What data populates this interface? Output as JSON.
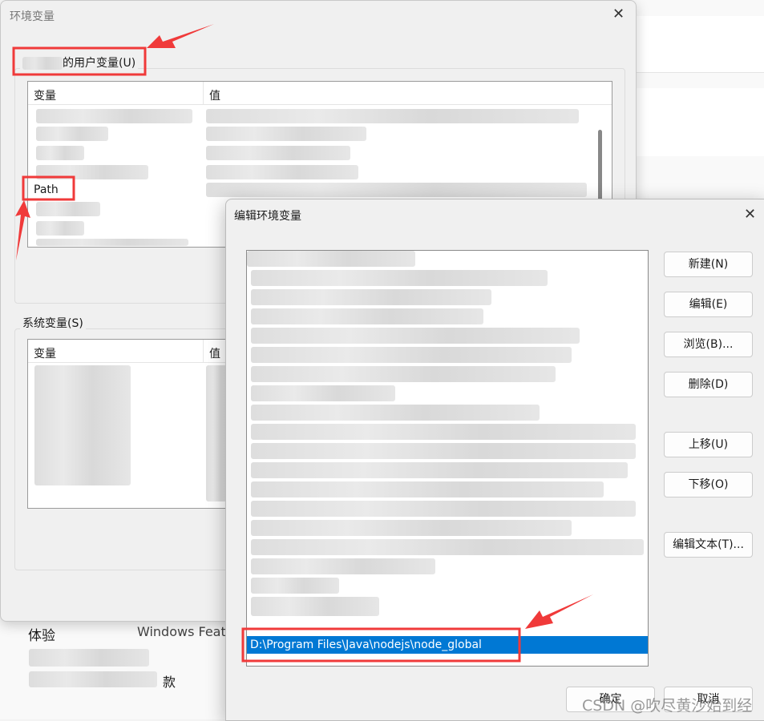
{
  "background_window": {
    "item_1": "体验",
    "item_2": "Windows Feat",
    "item_3": "款"
  },
  "env_dialog": {
    "title": "环境变量",
    "close_icon": "close-icon",
    "user_vars_label": "的用户变量(U)",
    "user_columns": [
      "变量",
      "值"
    ],
    "user_rows": [
      {
        "name": "Path",
        "value": ""
      }
    ],
    "system_vars_label": "系统变量(S)",
    "system_columns": [
      "变量",
      "值"
    ]
  },
  "edit_dialog": {
    "title": "编辑环境变量",
    "close_icon": "close-icon",
    "selected_entry": "D:\\Program Files\\Java\\nodejs\\node_global",
    "buttons": {
      "new": "新建(N)",
      "edit": "编辑(E)",
      "browse": "浏览(B)...",
      "delete": "删除(D)",
      "move_up": "上移(U)",
      "move_down": "下移(O)",
      "edit_text": "编辑文本(T)...",
      "ok": "确定",
      "cancel": "取消"
    }
  },
  "watermark": "CSDN @吹尽黄沙始到经",
  "colors": {
    "selection": "#0078d4",
    "annotation": "#f03a3a"
  }
}
